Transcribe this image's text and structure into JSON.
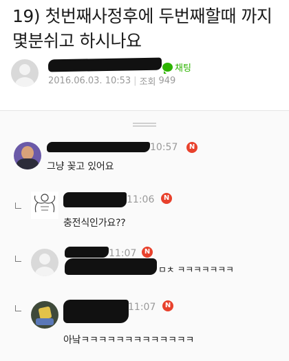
{
  "post": {
    "title": "19) 첫번째사정후에 두번째할때 까지 몇분쉬고 하시나요",
    "chat_label": "채팅",
    "date": "2016.06.03. 10:53",
    "views_label": "조회",
    "views": "949"
  },
  "comments": [
    {
      "time": "10:57",
      "badge": "N",
      "text": "그냥 꽂고 있어요"
    },
    {
      "time": "11:06",
      "badge": "N",
      "text": "충전식인가요??"
    },
    {
      "time": "11:07",
      "badge": "N",
      "text": "ㅁㅊ ㅋㅋㅋㅋㅋㅋㅋ"
    },
    {
      "time": "11:07",
      "badge": "N",
      "text": "아낰ㅋㅋㅋㅋㅋㅋㅋㅋㅋㅋㅋㅋㅋ"
    }
  ],
  "colors": {
    "accent_green": "#2db400",
    "badge_red": "#e8412c",
    "meta_gray": "#999999"
  },
  "icons": {
    "chat": "speech-bubble-icon",
    "new": "new-badge-icon",
    "reply": "reply-arrow-icon"
  }
}
